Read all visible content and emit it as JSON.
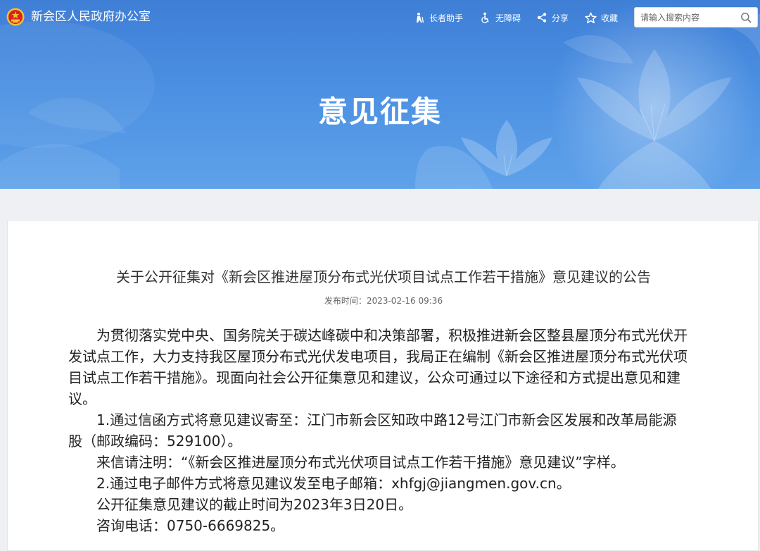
{
  "header": {
    "site_name": "新会区人民政府办公室",
    "banner_title": "意见征集",
    "tools": [
      {
        "label": "长者助手",
        "icon": "elder-assist-icon"
      },
      {
        "label": "无障碍",
        "icon": "accessibility-icon"
      },
      {
        "label": "分享",
        "icon": "share-icon"
      },
      {
        "label": "收藏",
        "icon": "star-icon"
      }
    ],
    "search": {
      "placeholder": "请输入搜索内容",
      "icon": "search-icon"
    }
  },
  "article": {
    "title": "关于公开征集对《新会区推进屋顶分布式光伏项目试点工作若干措施》意见建议的公告",
    "publish_label": "发布时间：",
    "publish_time": "2023-02-16 09:36",
    "paragraphs": [
      "为贯彻落实党中央、国务院关于碳达峰碳中和决策部署，积极推进新会区整县屋顶分布式光伏开发试点工作，大力支持我区屋顶分布式光伏发电项目，我局正在编制《新会区推进屋顶分布式光伏项目试点工作若干措施》。现面向社会公开征集意见和建议，公众可通过以下途径和方式提出意见和建议。",
      "1.通过信函方式将意见建议寄至：江门市新会区知政中路12号江门市新会区发展和改革局能源股（邮政编码：529100）。",
      "来信请注明：“《新会区推进屋顶分布式光伏项目试点工作若干措施》意见建议”字样。",
      "2.通过电子邮件方式将意见建议发至电子邮箱：xhfgj@jiangmen.gov.cn。",
      "公开征集意见建议的截止时间为2023年3日20日。",
      "咨询电话：0750-6669825。"
    ]
  },
  "colors": {
    "banner_top": "#3f7fd6",
    "banner_bottom": "#5fa2ea",
    "page_background": "#eef0f3",
    "text": "#222222"
  }
}
